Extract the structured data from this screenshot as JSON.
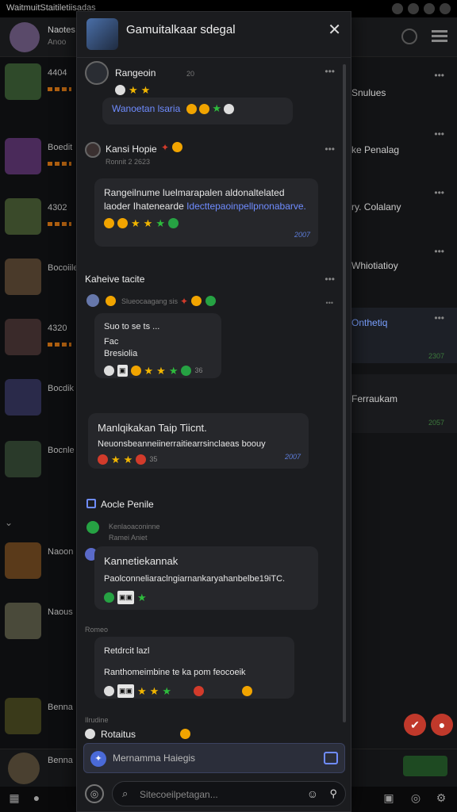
{
  "status_bar": {
    "left_text": "WaitmuitStaitiletiisadas"
  },
  "background": {
    "rows": [
      {
        "title": "Naotes",
        "sub": "Anoo"
      },
      {
        "title": "4404",
        "sub": ""
      },
      {
        "title": "Boedit",
        "sub": ""
      },
      {
        "title": "4302",
        "sub": ""
      },
      {
        "title": "Bocoiile",
        "sub": ""
      },
      {
        "title": "4320",
        "sub": ""
      },
      {
        "title": "Bocdik",
        "sub": ""
      },
      {
        "title": "Bocnle",
        "sub": ""
      },
      {
        "title": "Naoon",
        "sub": ""
      },
      {
        "title": "Naous",
        "sub": ""
      },
      {
        "title": "Benna",
        "sub": ""
      }
    ],
    "right_items": [
      {
        "label": "Snulues"
      },
      {
        "label": "ke Penalag"
      },
      {
        "label": "ry. Colalany"
      },
      {
        "label": "Whiotiatioy"
      },
      {
        "label": "Onthetiq"
      },
      {
        "label": "Ferraukam"
      }
    ],
    "right_times": [
      "2307",
      "2057"
    ]
  },
  "modal": {
    "title": "Gamuitalkaar sdegal",
    "close_icon": "close-icon",
    "messages": [
      {
        "sender": "Rangeoin",
        "date": "",
        "meta": "20",
        "text": "Wanoetan lsaria",
        "is_link": true,
        "time": ""
      },
      {
        "sender": "Kansi Hopie",
        "date": "Ronnit 2 2623",
        "text": "Rangeilnume luelmarapalen aldonaltelated laoder Ihatenearde",
        "link": "Idecttepaoinpellpnonabarve.",
        "time": "2007"
      },
      {
        "section": "Kaheive tacite",
        "sub": "Slueocaagang sis",
        "text1": "Suo to se ts ...",
        "text2": "Fac",
        "text3": "Bresiolia",
        "count": "36"
      },
      {
        "sender": "Manlqikakan Taip Tiicnt.",
        "text": "Neuonsbeanneiinerraitiearrsinclaeas boouy",
        "count": "35",
        "time": "2007"
      },
      {
        "section": "Aocle Penile",
        "sub": "Kenlaoaconinne",
        "sub2": "Ramei Aniet",
        "sender": "Kannetiekannak",
        "text": "Paolconneliaraclngiarnankaryahanbelbe19iTC."
      },
      {
        "date": "Romeo",
        "text1": "Retdrcit lazl",
        "text2": "Ranthomeimbine te ka pom feocoeik"
      },
      {
        "sender": "Rotaitus",
        "date": "Ilrudine"
      }
    ],
    "reply_label": "Mernamma Haiegis",
    "input_placeholder": "Sitecoeilpetagan..."
  }
}
